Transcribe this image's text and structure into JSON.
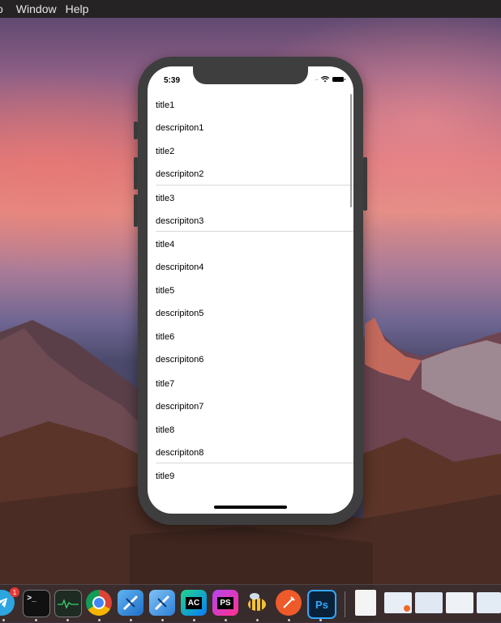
{
  "menubar": {
    "items": [
      "o",
      "Window",
      "Help"
    ]
  },
  "phone": {
    "status_time": "5:39",
    "list": [
      {
        "title": "title1",
        "description": "descripiton1"
      },
      {
        "title": "title2",
        "description": "descripiton2"
      },
      {
        "title": "title3",
        "description": "descripiton3"
      },
      {
        "title": "title4",
        "description": "descripiton4"
      },
      {
        "title": "title5",
        "description": "descripiton5"
      },
      {
        "title": "title6",
        "description": "descripiton6"
      },
      {
        "title": "title7",
        "description": "descripiton7"
      },
      {
        "title": "title8",
        "description": "descripiton8"
      },
      {
        "title": "title9"
      }
    ]
  },
  "dock": {
    "telegram_badge": "1",
    "apps": [
      {
        "name": "telegram-icon",
        "label": "",
        "color": "#2ca5e0"
      },
      {
        "name": "terminal-icon",
        "label": ">_",
        "color": "#111111"
      },
      {
        "name": "activity-monitor-icon",
        "label": "",
        "color": "#1e2b22"
      },
      {
        "name": "chrome-icon",
        "label": "",
        "color": "#ffffff"
      },
      {
        "name": "xcode-icon",
        "label": "",
        "color": "#1f7fd8"
      },
      {
        "name": "xcode-beta-icon",
        "label": "",
        "color": "#3a8ee6"
      },
      {
        "name": "appcode-icon",
        "label": "AC",
        "color": "#1b9fe0"
      },
      {
        "name": "phpstorm-icon",
        "label": "PS",
        "color": "#8a3ac7"
      },
      {
        "name": "bee-app-icon",
        "label": "",
        "color": "#f3c23d"
      },
      {
        "name": "paw-app-icon",
        "label": "",
        "color": "#ef5a2a"
      },
      {
        "name": "photoshop-icon",
        "label": "Ps",
        "color": "#0a2239"
      }
    ],
    "documents": [
      {
        "name": "document-icon"
      },
      {
        "name": "recent-document-1-icon"
      },
      {
        "name": "recent-document-2-icon"
      },
      {
        "name": "recent-document-3-icon"
      },
      {
        "name": "recent-document-4-icon"
      }
    ]
  }
}
